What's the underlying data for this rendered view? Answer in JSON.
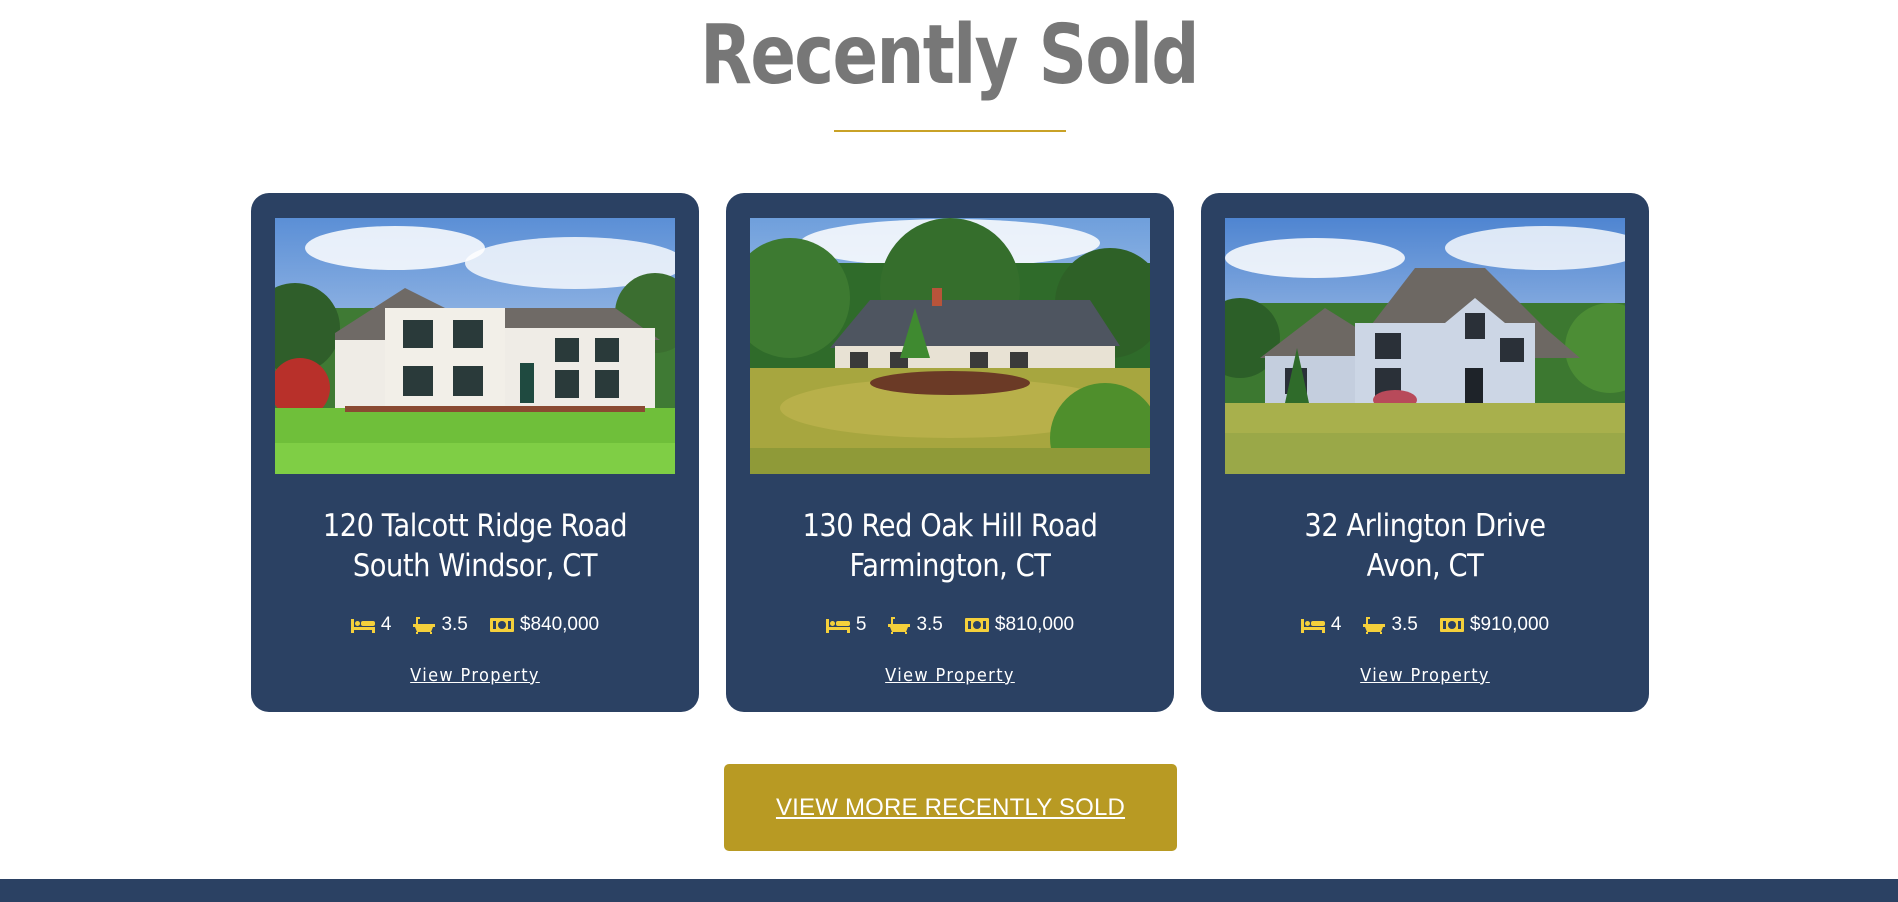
{
  "section": {
    "title": "Recently Sold"
  },
  "colors": {
    "accent": "#c9a227",
    "card_bg": "#2b4163",
    "button_bg": "#b89a23",
    "icon_yellow": "#f5d03b"
  },
  "listings": [
    {
      "street": "120 Talcott Ridge Road",
      "city": "South Windsor, CT",
      "beds": "4",
      "baths": "3.5",
      "price": "$840,000",
      "link_label": "View Property"
    },
    {
      "street": "130 Red Oak Hill Road",
      "city": "Farmington, CT",
      "beds": "5",
      "baths": "3.5",
      "price": "$810,000",
      "link_label": "View Property"
    },
    {
      "street": "32 Arlington Drive",
      "city": "Avon, CT",
      "beds": "4",
      "baths": "3.5",
      "price": "$910,000",
      "link_label": "View Property"
    }
  ],
  "icons": {
    "beds": "bed-icon",
    "baths": "bathtub-icon",
    "price": "money-icon"
  },
  "cta": {
    "label": "VIEW MORE RECENTLY SOLD"
  }
}
